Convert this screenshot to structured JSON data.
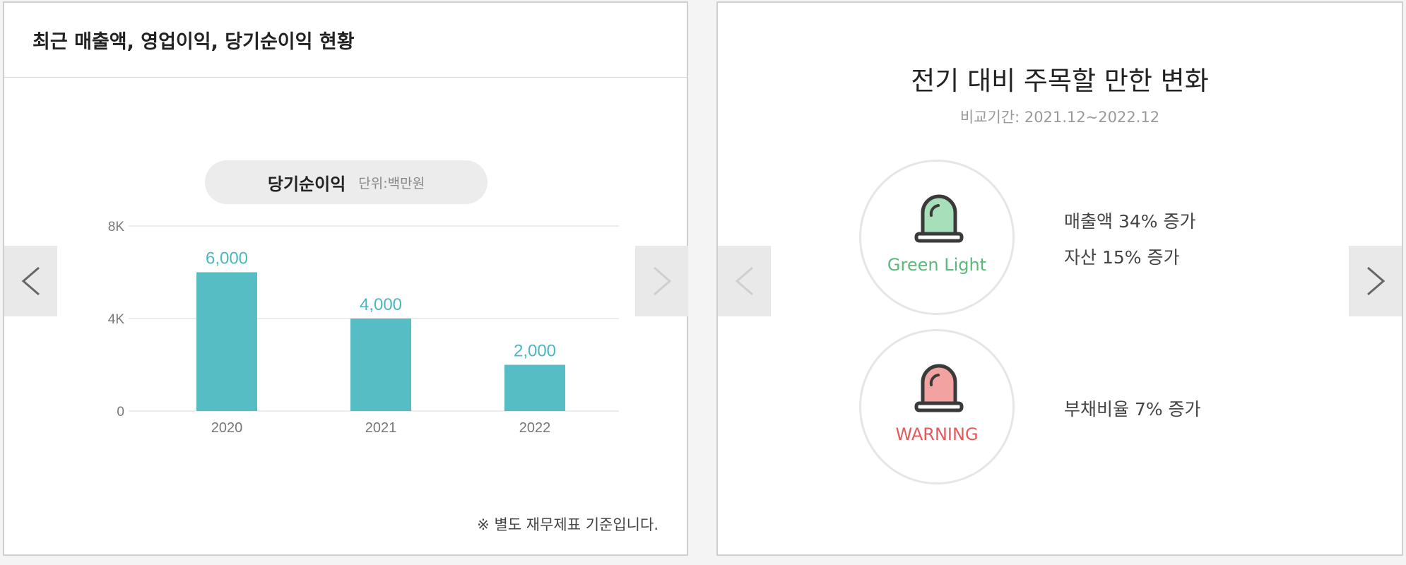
{
  "left_panel": {
    "title": "최근 매출액, 영업이익, 당기순이익 현황",
    "chart_pill": {
      "title": "당기순이익",
      "unit": "단위:백만원"
    },
    "footnote": "※ 별도 재무제표 기준입니다.",
    "prev_icon": "chevron-left-icon",
    "next_icon": "chevron-right-icon"
  },
  "chart_data": {
    "type": "bar",
    "title": "당기순이익",
    "categories": [
      "2020",
      "2021",
      "2022"
    ],
    "values": [
      6000,
      4000,
      2000
    ],
    "value_labels": [
      "6,000",
      "4,000",
      "2,000"
    ],
    "y_ticks": [
      "0",
      "4K",
      "8K"
    ],
    "ylim": [
      0,
      8000
    ],
    "grid": true,
    "bar_color": "#56bdc5",
    "label_color": "#4bb7bf"
  },
  "right_panel": {
    "title": "전기 대비 주목할 만한 변화",
    "subtitle": "비교기간: 2021.12~2022.12",
    "signals": [
      {
        "label": "Green Light",
        "icon": "green-siren-icon",
        "color": "#5cb97b",
        "changes": [
          "매출액 34% 증가",
          "자산 15% 증가"
        ]
      },
      {
        "label": "WARNING",
        "icon": "red-siren-icon",
        "color": "#e5595a",
        "changes": [
          "부채비율 7% 증가"
        ]
      }
    ],
    "prev_icon": "chevron-left-icon",
    "next_icon": "chevron-right-icon"
  }
}
